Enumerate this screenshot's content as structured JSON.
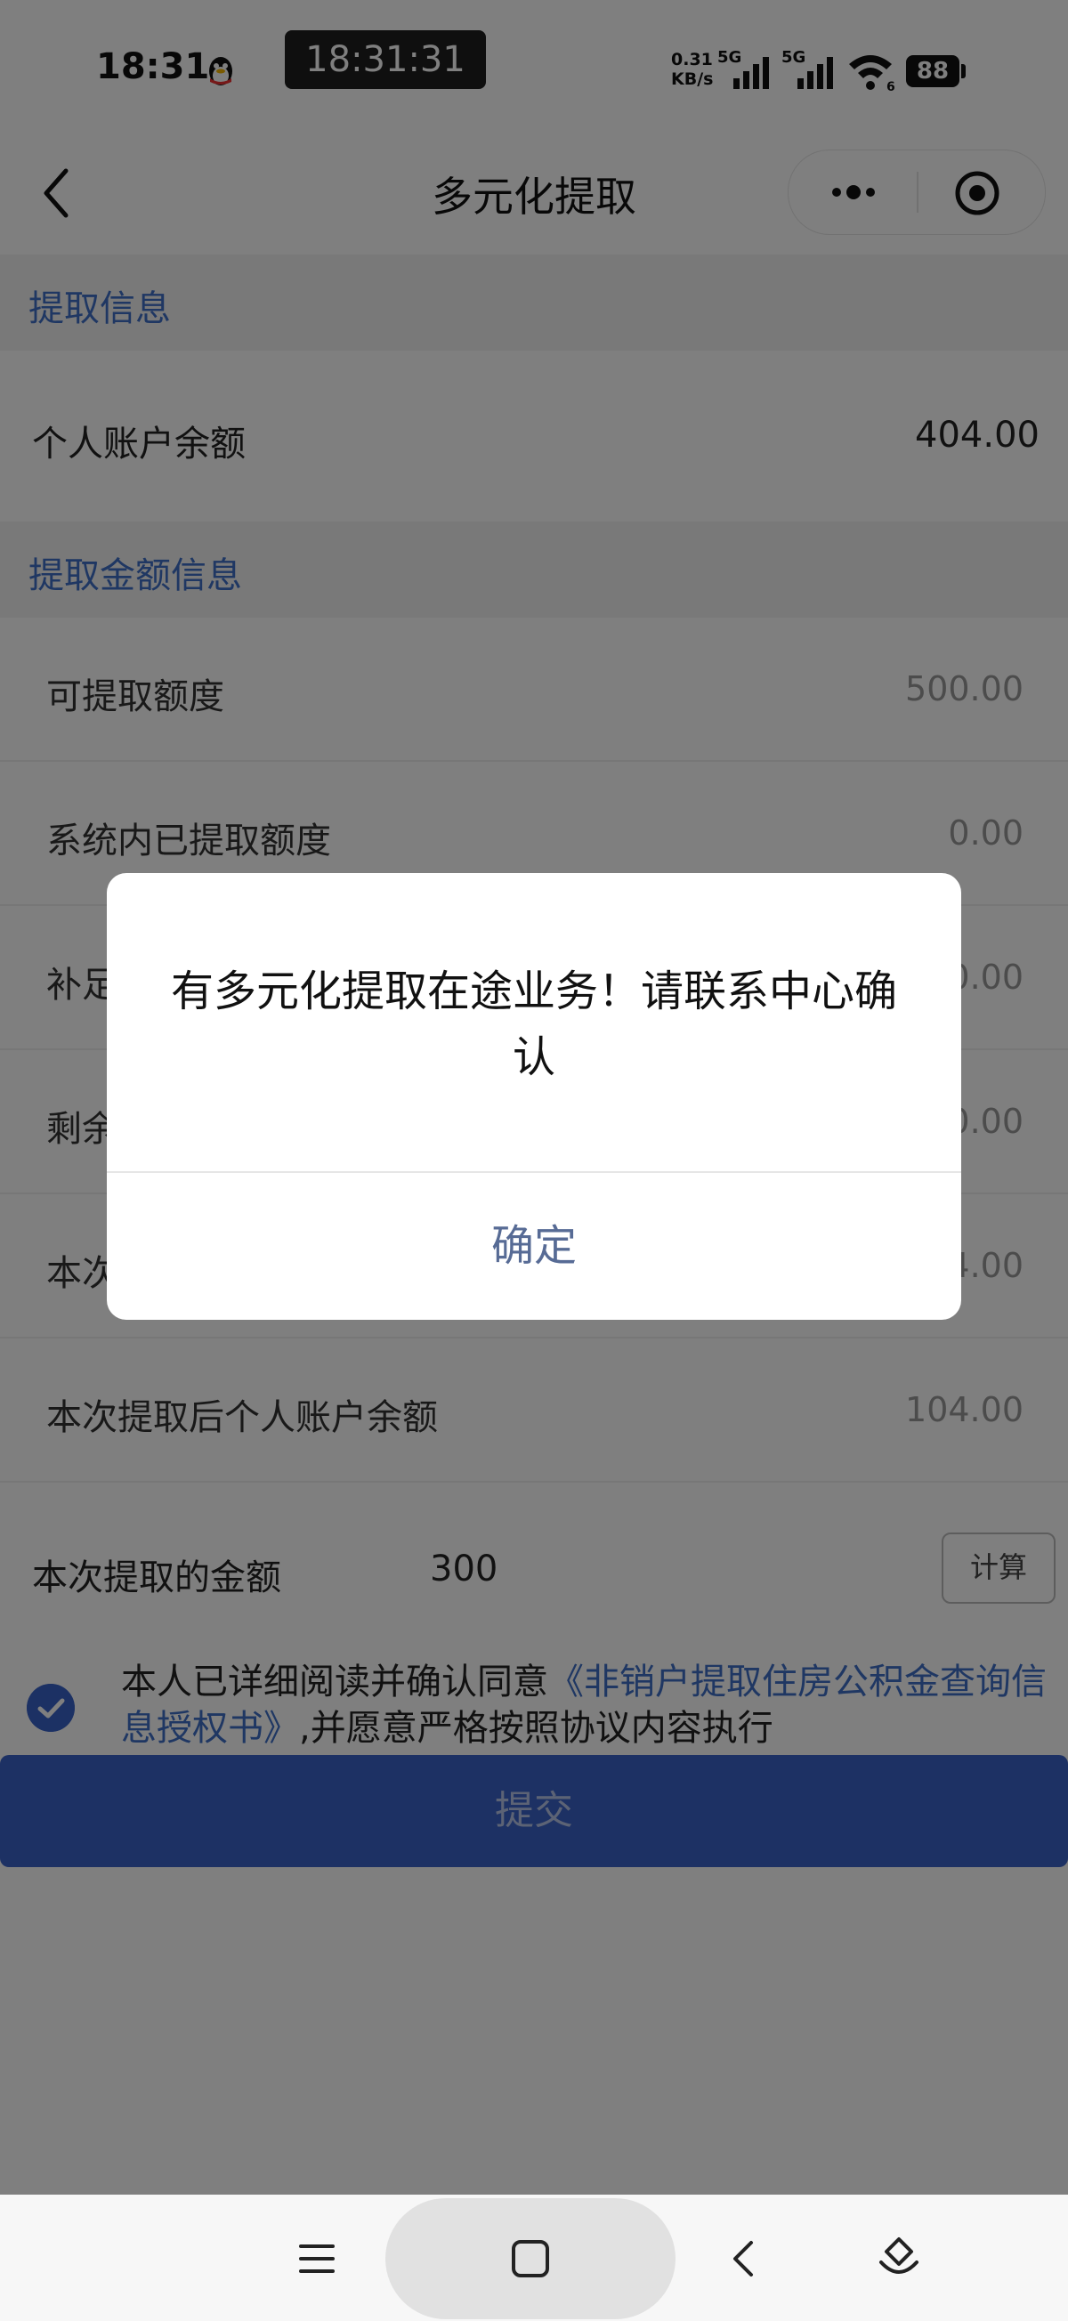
{
  "status_bar": {
    "time": "18:31",
    "clock": "18:31:31",
    "net_speed_value": "0.31",
    "net_speed_unit": "KB/s",
    "signal_label_1": "5G",
    "signal_label_2": "5G",
    "wifi_label": "6",
    "battery": "88"
  },
  "nav": {
    "title": "多元化提取"
  },
  "section_1": {
    "title": "提取信息",
    "rows": [
      {
        "label": "个人账户余额",
        "value": "404.00"
      }
    ]
  },
  "section_2": {
    "title": "提取金额信息",
    "rows": [
      {
        "label": "可提取额度",
        "value": "500.00"
      },
      {
        "label": "系统内已提取额度",
        "value": "0.00"
      },
      {
        "label": "补足",
        "value": "0.00"
      },
      {
        "label": "剩余",
        "value": "0.00"
      },
      {
        "label": "本次",
        "value": "4.00"
      },
      {
        "label": "本次提取后个人账户余额",
        "value": "104.00"
      }
    ]
  },
  "amount_row": {
    "label": "本次提取的金额",
    "value": "300",
    "calc_label": "计算"
  },
  "agreement": {
    "prefix": "本人已详细阅读并确认同意",
    "link": "《非销户提取住房公积金查询信息授权书》",
    "suffix": ",并愿意严格按照协议内容执行"
  },
  "submit_label": "提交",
  "dialog": {
    "message": "有多元化提取在途业务！请联系中心确认",
    "ok_label": "确定"
  },
  "colors": {
    "accent": "#3e6fc6",
    "button": "#3a62c9",
    "dialog_ok": "#576b95"
  }
}
